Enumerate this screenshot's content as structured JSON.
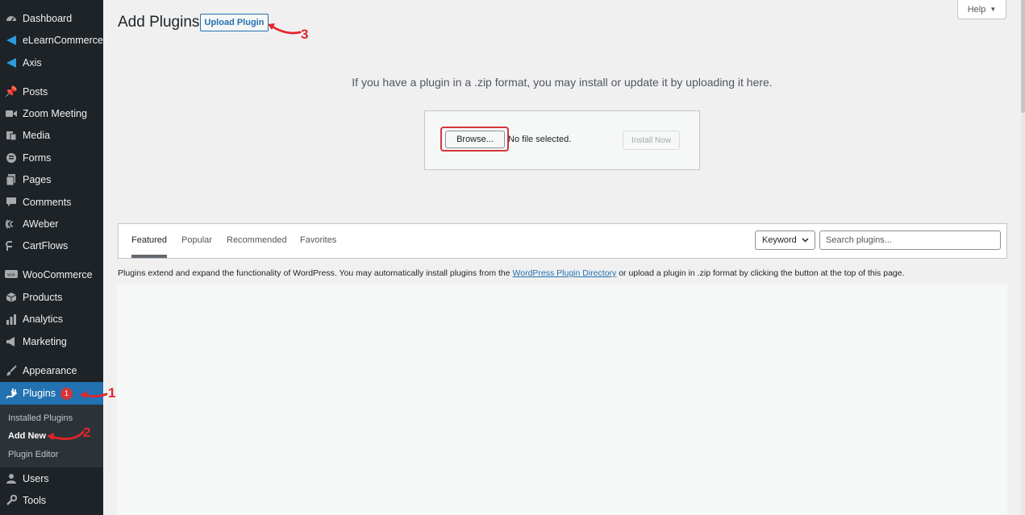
{
  "sidebar": {
    "items": [
      {
        "label": "Dashboard",
        "icon": "dashboard-icon"
      },
      {
        "label": "eLearnCommerce",
        "icon": "elearn-icon"
      },
      {
        "label": "Axis",
        "icon": "axis-icon"
      },
      {
        "label": "Posts",
        "icon": "pushpin-icon"
      },
      {
        "label": "Zoom Meeting",
        "icon": "video-icon"
      },
      {
        "label": "Media",
        "icon": "media-icon"
      },
      {
        "label": "Forms",
        "icon": "forms-icon"
      },
      {
        "label": "Pages",
        "icon": "pages-icon"
      },
      {
        "label": "Comments",
        "icon": "comment-icon"
      },
      {
        "label": "AWeber",
        "icon": "aweber-icon"
      },
      {
        "label": "CartFlows",
        "icon": "cartflows-icon"
      },
      {
        "label": "WooCommerce",
        "icon": "woocommerce-icon"
      },
      {
        "label": "Products",
        "icon": "products-icon"
      },
      {
        "label": "Analytics",
        "icon": "analytics-icon"
      },
      {
        "label": "Marketing",
        "icon": "megaphone-icon"
      },
      {
        "label": "Appearance",
        "icon": "brush-icon"
      },
      {
        "label": "Plugins",
        "icon": "plugin-icon",
        "badge": "1"
      },
      {
        "label": "Users",
        "icon": "user-icon"
      },
      {
        "label": "Tools",
        "icon": "wrench-icon"
      }
    ],
    "submenu": [
      "Installed Plugins",
      "Add New",
      "Plugin Editor"
    ]
  },
  "header": {
    "title": "Add Plugins",
    "upload_button": "Upload Plugin",
    "help_button": "Help"
  },
  "upload": {
    "description": "If you have a plugin in a .zip format, you may install or update it by uploading it here.",
    "browse_button": "Browse...",
    "file_status": "No file selected.",
    "install_button": "Install Now"
  },
  "filter": {
    "tabs": [
      "Featured",
      "Popular",
      "Recommended",
      "Favorites"
    ],
    "keyword_select": "Keyword",
    "search_placeholder": "Search plugins..."
  },
  "intro": {
    "before": "Plugins extend and expand the functionality of WordPress. You may automatically install plugins from the ",
    "link": "WordPress Plugin Directory",
    "after": " or upload a plugin in .zip format by clicking the button at the top of this page."
  },
  "annotations": [
    "1",
    "2",
    "3"
  ],
  "colors": {
    "sidebar_bg": "#1d2327",
    "active_bg": "#2271b1",
    "annotation_red": "#e3242b"
  }
}
